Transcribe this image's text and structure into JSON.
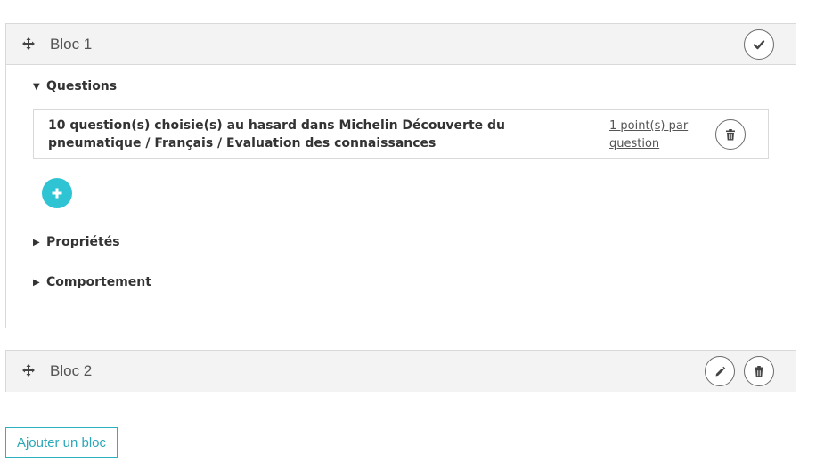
{
  "blocks": [
    {
      "title": "Bloc 1",
      "header_action_icon": "check-icon",
      "sections": {
        "questions_label": "Questions",
        "proprietes_label": "Propriétés",
        "comportement_label": "Comportement"
      },
      "question": {
        "text": "10 question(s) choisie(s) au hasard dans Michelin Découverte du pneumatique / Français / Evaluation des connaissances",
        "points_link": "1 point(s) par question"
      }
    },
    {
      "title": "Bloc 2"
    }
  ],
  "actions": {
    "add_block_label": "Ajouter un bloc"
  },
  "colors": {
    "accent": "#2fc4d3",
    "header_bg": "#f3f3f3",
    "border": "#d9d9d9"
  }
}
